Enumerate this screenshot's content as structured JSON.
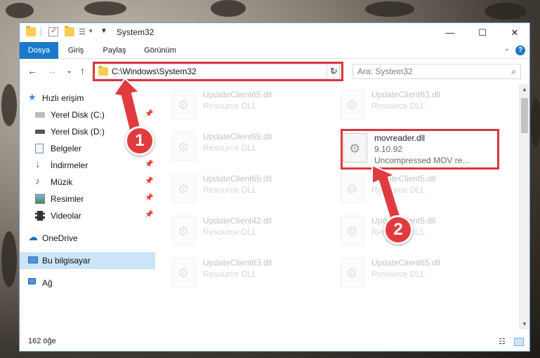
{
  "window": {
    "title": "System32",
    "minimize": "—",
    "maximize": "☐",
    "close": "✕"
  },
  "ribbon": {
    "tabs": [
      "Dosya",
      "Giriş",
      "Paylaş",
      "Görünüm"
    ],
    "active_tab": "Dosya",
    "help": "?",
    "collapse": "⌄"
  },
  "nav": {
    "back": "←",
    "forward": "→",
    "recent": "⌄",
    "up": "↑",
    "address": "C:\\Windows\\System32",
    "address_dropdown": "⌄",
    "refresh": "↻",
    "search_placeholder": "Ara: System32",
    "search_icon": "⌕"
  },
  "sidebar": {
    "quick_access": "Hızlı erişim",
    "items": [
      {
        "label": "Yerel Disk (C:)",
        "icon": "drive-icon",
        "pinned": true
      },
      {
        "label": "Yerel Disk (D:)",
        "icon": "drive-icon",
        "pinned": false
      },
      {
        "label": "Belgeler",
        "icon": "documents-icon",
        "pinned": true
      },
      {
        "label": "İndirmeler",
        "icon": "downloads-icon",
        "pinned": true
      },
      {
        "label": "Müzik",
        "icon": "music-icon",
        "pinned": true
      },
      {
        "label": "Resimler",
        "icon": "pictures-icon",
        "pinned": true
      },
      {
        "label": "Videolar",
        "icon": "videos-icon",
        "pinned": true
      }
    ],
    "onedrive": "OneDrive",
    "this_pc": "Bu bilgisayar",
    "network": "Ağ",
    "pin_glyph": "📌"
  },
  "files": {
    "left": [
      {
        "name": "UpdateClient65.dll",
        "type": "Resource DLL"
      },
      {
        "name": "UpdateClient65.dll",
        "type": "Resource DLL"
      },
      {
        "name": "UpdateClient65.dll",
        "type": "Resource DLL"
      },
      {
        "name": "UpdateClient42.dll",
        "type": "Resource DLL"
      },
      {
        "name": "UpdateClient63.dll",
        "type": "Resource DLL"
      }
    ],
    "right": [
      {
        "name": "UpdateClient63.dll",
        "type": "Resource DLL"
      },
      {
        "name": "UpdateClient5.dll",
        "type": "Resource DLL"
      },
      {
        "name": "UpdateClient5.dll",
        "type": "Resource DLL"
      },
      {
        "name": "UpdateClient65.dll",
        "type": "Resource DLL"
      }
    ],
    "highlighted": {
      "name": "movreader.dll",
      "version": "9.10.92",
      "description": "Uncompressed MOV re..."
    }
  },
  "status": {
    "count": "162 öğe"
  },
  "callouts": [
    "1",
    "2"
  ],
  "colors": {
    "accent": "#1979ca",
    "highlight_red": "#d9363e",
    "callout_red": "#e03c40"
  }
}
